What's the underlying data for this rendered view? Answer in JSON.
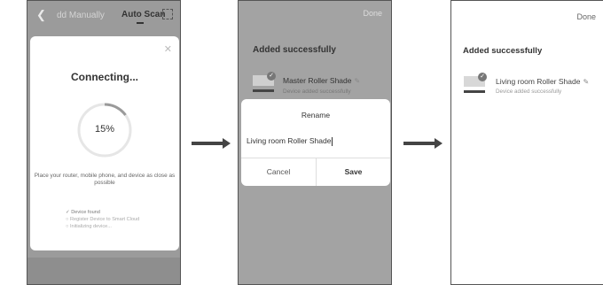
{
  "screen1": {
    "back_icon": "chevron-left-icon",
    "tab_manual": "dd Manually",
    "tab_auto": "Auto Scan",
    "scan_icon": "scan-frame-icon",
    "modal": {
      "close_icon": "close-icon",
      "title": "Connecting...",
      "progress_value": 15,
      "progress_label": "15%",
      "hint": "Place your router, mobile phone, and device as close as possible",
      "steps": [
        {
          "label": "Device found",
          "state": "done"
        },
        {
          "label": "Register Device to Smart Cloud",
          "state": "pending"
        },
        {
          "label": "Initializing device...",
          "state": "pending"
        }
      ]
    }
  },
  "screen2": {
    "done_label": "Done",
    "added_title": "Added successfully",
    "device_name": "Master Roller Shade",
    "device_status": "Device added successfully",
    "dialog": {
      "title": "Rename",
      "input_value": "Living room Roller Shade",
      "cancel_label": "Cancel",
      "save_label": "Save"
    }
  },
  "screen3": {
    "done_label": "Done",
    "added_title": "Added successfully",
    "device_name": "Living room Roller Shade",
    "device_status": "Device added successfully"
  },
  "colors": {
    "dim_overlay": "#9b9b9b",
    "progress_arc": "#9a9a9a",
    "progress_track": "#e6e6e6",
    "arrow": "#444444"
  }
}
